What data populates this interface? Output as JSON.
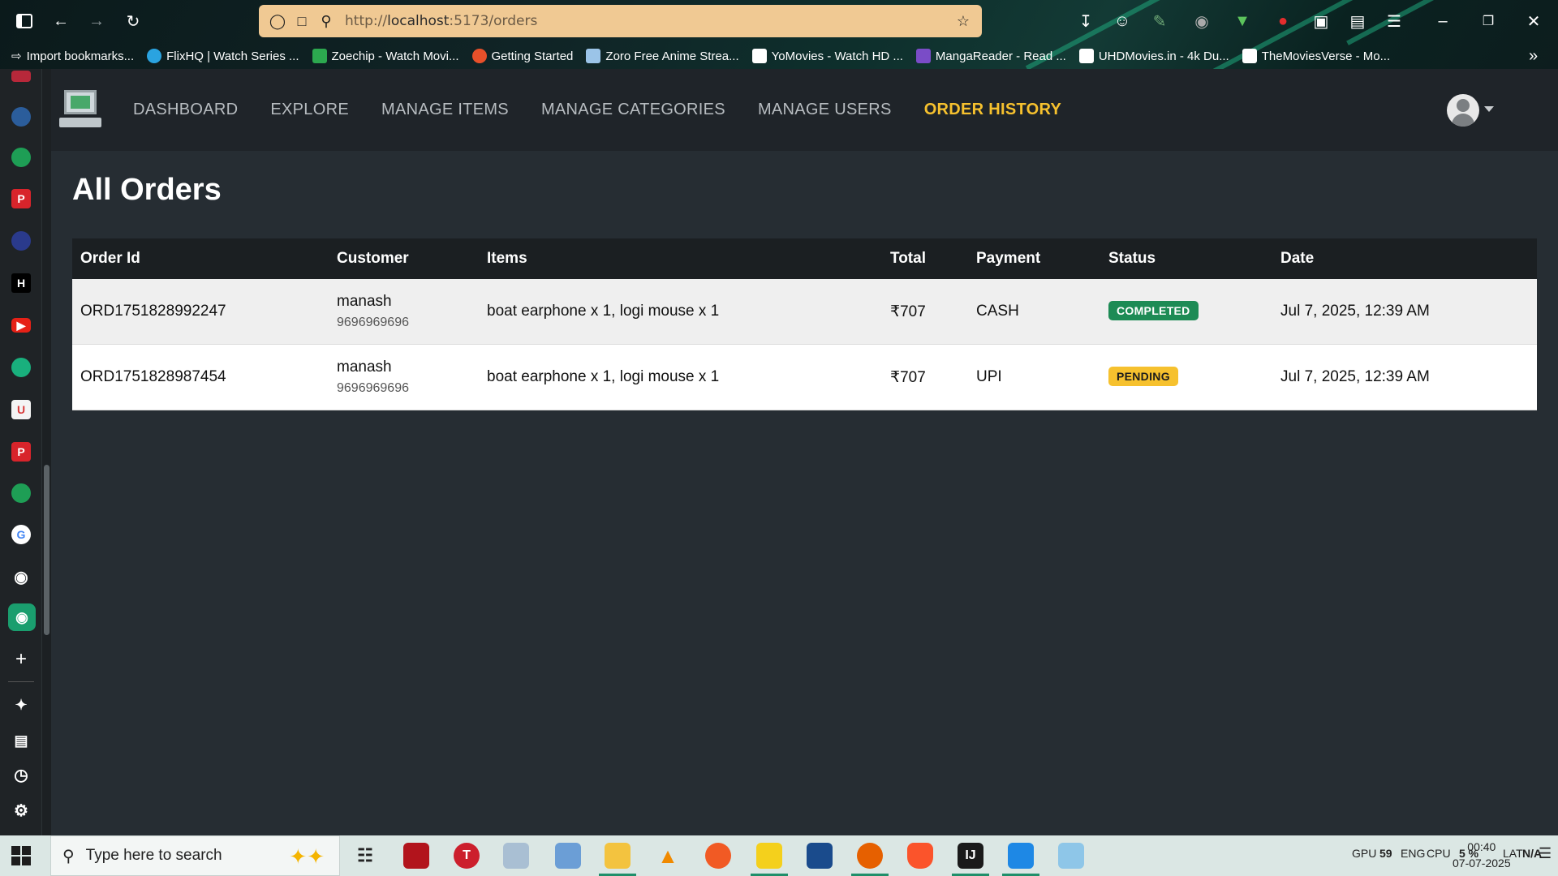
{
  "browser": {
    "url_prefix": "http://",
    "url_host": "localhost",
    "url_path": ":5173/orders",
    "bookmarks": [
      {
        "label": "Import bookmarks...",
        "color": "#ffffff"
      },
      {
        "label": "FlixHQ | Watch Series ...",
        "color": "#2aa3e0"
      },
      {
        "label": "Zoechip - Watch Movi...",
        "color": "#2ca84f"
      },
      {
        "label": "Getting Started",
        "color": "#e8502a"
      },
      {
        "label": "Zoro Free Anime Strea...",
        "color": "#9bc4e8"
      },
      {
        "label": "YoMovies - Watch HD ...",
        "color": "#ffffff"
      },
      {
        "label": "MangaReader - Read ...",
        "color": "#7a4cc7"
      },
      {
        "label": "UHDMovies.in - 4k Du...",
        "color": "#ffffff"
      },
      {
        "label": "TheMoviesVerse - Mo...",
        "color": "#ffffff"
      }
    ]
  },
  "nav": {
    "links": [
      "DASHBOARD",
      "EXPLORE",
      "MANAGE ITEMS",
      "MANAGE CATEGORIES",
      "MANAGE USERS",
      "ORDER HISTORY"
    ],
    "active": "ORDER HISTORY",
    "accent": "#f6c12e"
  },
  "page": {
    "title": "All Orders"
  },
  "table": {
    "headers": [
      "Order Id",
      "Customer",
      "Items",
      "Total",
      "Payment",
      "Status",
      "Date"
    ],
    "rows": [
      {
        "order_id": "ORD1751828992247",
        "customer_name": "manash",
        "customer_phone": "9696969696",
        "items": "boat earphone x 1, logi mouse x 1",
        "total": "₹707",
        "payment": "CASH",
        "status": "COMPLETED",
        "date": "Jul 7, 2025, 12:39 AM"
      },
      {
        "order_id": "ORD1751828987454",
        "customer_name": "manash",
        "customer_phone": "9696969696",
        "items": "boat earphone x 1, logi mouse x 1",
        "total": "₹707",
        "payment": "UPI",
        "status": "PENDING",
        "date": "Jul 7, 2025, 12:39 AM"
      }
    ],
    "status_colors": {
      "COMPLETED": "#1d8b55",
      "PENDING": "#f6c12e"
    }
  },
  "taskbar": {
    "search_placeholder": "Type here to search",
    "tray_gpu": "GPU",
    "tray_gpu_val": "59",
    "tray_lang": "ENG",
    "tray_cpu": "CPU",
    "tray_cpu_val": "5 %",
    "tray_lat": "LAT",
    "tray_lat_val": "N/A",
    "time": "00:40",
    "date": "07-07-2025"
  }
}
